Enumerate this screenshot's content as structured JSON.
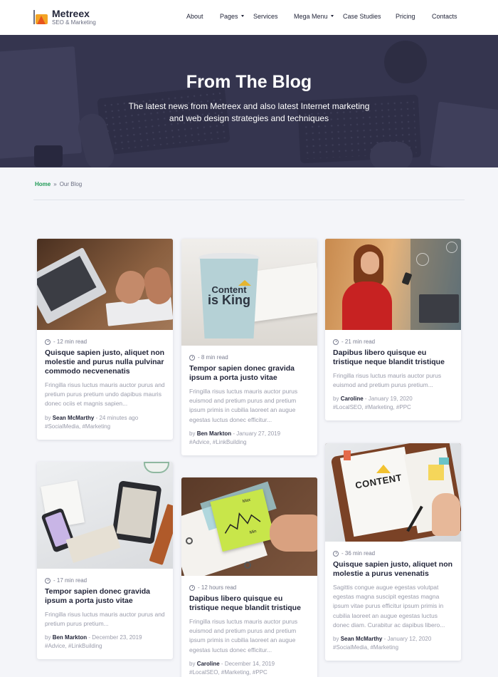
{
  "header": {
    "brand": "Metreex",
    "tagline": "SEO & Marketing",
    "nav": [
      "About",
      "Pages",
      "Services",
      "Mega Menu",
      "Case Studies",
      "Pricing",
      "Contacts"
    ]
  },
  "hero": {
    "title": "From The Blog",
    "subtitle_line1": "The latest news from Metreex and also latest Internet marketing",
    "subtitle_line2": "and web design strategies and techniques"
  },
  "breadcrumb": {
    "home": "Home",
    "separator": "»",
    "current": "Our Blog"
  },
  "posts": [
    {
      "read_time": "- 12 min read",
      "title": "Quisque sapien justo, aliquet non molestie and purus nulla pulvinar commodo necvenenatis",
      "excerpt": "Fringilla risus luctus mauris auctor purus and pretium purus pretium undo dapibus mauris donec ociis et magnis sapien...",
      "by": "by",
      "author": "Sean McMarthy",
      "date": " - 24 minutes ago",
      "tags": "#SocialMedia, #Marketing",
      "image": "laptop-typing"
    },
    {
      "read_time": "- 8 min read",
      "title": "Tempor sapien donec gravida ipsum a porta justo vitae",
      "excerpt": "Fringilla risus luctus mauris auctor purus euismod and pretium purus and pretium ipsum primis in cubilia laoreet an augue egestas luctus donec efficitur...",
      "by": "by",
      "author": "Ben Markton",
      "date": " - January 27, 2019",
      "tags": "#Advice, #LinkBuilding",
      "image": "content-is-king-cup",
      "cup_text_1": "Content",
      "cup_text_2": "is King"
    },
    {
      "read_time": "- 21 min read",
      "title": "Dapibus libero quisque eu tristique neque blandit tristique",
      "excerpt": "Fringilla risus luctus mauris auctor purus euismod and pretium purus pretium...",
      "by": "by",
      "author": "Caroline",
      "date": " - January 19, 2020",
      "tags": "#LocalSEO, #Marketing, #PPC",
      "image": "woman-phone"
    },
    {
      "read_time": "- 17 min read",
      "title": "Tempor sapien donec gravida ipsum a porta justo vitae",
      "excerpt": "Fringilla risus luctus mauris auctor purus and pretium purus pretium...",
      "by": "by",
      "author": "Ben Markton",
      "date": " - December 23, 2019",
      "tags": "#Advice, #LinkBuilding",
      "image": "desk-devices"
    },
    {
      "read_time": "- 12 hours read",
      "title": "Dapibus libero quisque eu tristique neque blandit tristique",
      "excerpt": "Fringilla risus luctus mauris auctor purus euismod and pretium purus and pretium ipsum primis in cubilia laoreet an augue egestas luctus donec efficitur...",
      "by": "by",
      "author": "Caroline",
      "date": " - December 14, 2019",
      "tags": "#LocalSEO, #Marketing, #PPC",
      "image": "sticky-note-chart",
      "note_label_1": "Max",
      "note_label_2": "Min"
    },
    {
      "read_time": "- 36 min read",
      "title": "Quisque sapien justo, aliquet non molestie a purus venenatis",
      "excerpt": "Sagittis congue augue egestas volutpat egestas magna suscipit egestas magna ipsum vitae purus efficitur ipsum primis in cubilia laoreet an augue egestas luctus donec diam. Curabitur ac dapibus libero...",
      "by": "by",
      "author": "Sean McMarthy",
      "date": " - January 12, 2020",
      "tags": "#SocialMedia, #Marketing",
      "image": "content-notebook",
      "notebook_text": "CONTENT"
    }
  ],
  "colors": {
    "accent_green": "#1f9a56",
    "logo_orange": "#f3a425",
    "logo_red": "#e8541e",
    "hero_bg": "#3e3f58",
    "page_bg": "#f4f5f9"
  }
}
